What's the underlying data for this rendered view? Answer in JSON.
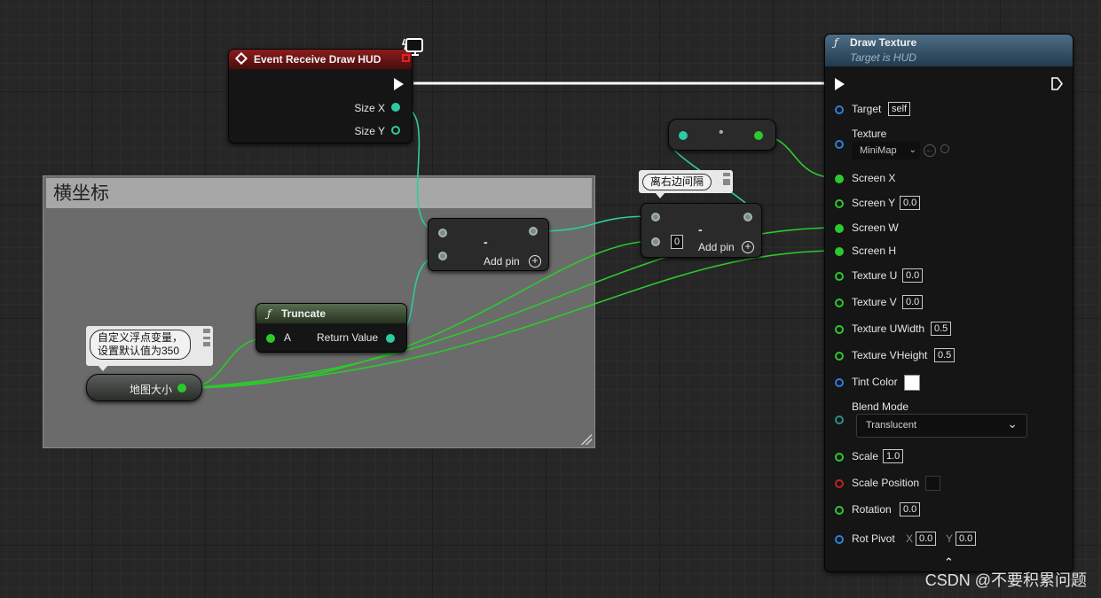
{
  "comment_box": {
    "title": "横坐标"
  },
  "event_node": {
    "title": "Event Receive Draw HUD",
    "outputs": {
      "size_x": "Size X",
      "size_y": "Size Y"
    }
  },
  "subtract_node_1": {
    "operator": "-",
    "add_pin": "Add pin"
  },
  "subtract_node_2": {
    "operator": "-",
    "add_pin": "Add pin",
    "b_value": "0",
    "comment": "离右边间隔"
  },
  "reroute_node": {
    "dot": "•"
  },
  "truncate_node": {
    "title": "Truncate",
    "input": "A",
    "output": "Return Value"
  },
  "variable_node": {
    "name": "地图大小",
    "comment_line1": "自定义浮点变量，",
    "comment_line2": "设置默认值为350"
  },
  "draw_texture": {
    "title": "Draw Texture",
    "subtitle": "Target is HUD",
    "pins": {
      "target": "Target",
      "target_value": "self",
      "texture": "Texture",
      "texture_value": "MiniMap",
      "screen_x": "Screen X",
      "screen_y": "Screen Y",
      "screen_y_value": "0.0",
      "screen_w": "Screen W",
      "screen_h": "Screen H",
      "texture_u": "Texture U",
      "texture_u_value": "0.0",
      "texture_v": "Texture V",
      "texture_v_value": "0.0",
      "texture_uwidth": "Texture UWidth",
      "texture_uwidth_value": "0.5",
      "texture_vheight": "Texture VHeight",
      "texture_vheight_value": "0.5",
      "tint_color": "Tint Color",
      "tint_color_value": "#ffffff",
      "blend_mode": "Blend Mode",
      "blend_mode_value": "Translucent",
      "scale": "Scale",
      "scale_value": "1.0",
      "scale_position": "Scale Position",
      "rotation": "Rotation",
      "rotation_value": "0.0",
      "rot_pivot": "Rot Pivot",
      "rot_pivot_x_label": "X",
      "rot_pivot_x": "0.0",
      "rot_pivot_y_label": "Y",
      "rot_pivot_y": "0.0"
    }
  },
  "watermark": "CSDN @不要积累问题",
  "colors": {
    "exec_wire": "#ffffff",
    "float_wire": "#2cc92c",
    "double_wire": "#2ecba0",
    "event_header": "#8a1c1c",
    "function_header": "#566b4f",
    "target_header": "#4d6d85"
  }
}
